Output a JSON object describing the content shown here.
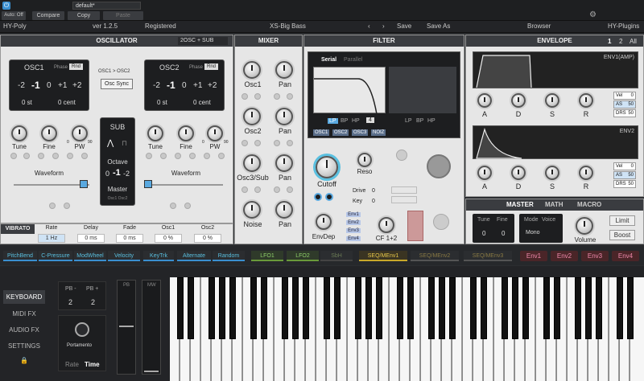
{
  "host": {
    "power_label": "⏻",
    "autooff": "Auto: Off",
    "preset": "default*",
    "compare": "Compare",
    "copy": "Copy",
    "paste": "Paste",
    "gear": "⚙"
  },
  "header": {
    "name": "HY-Poly",
    "version": "ver 1.2.5",
    "registered": "Registered",
    "preset": "XS-Big Bass",
    "save": "Save",
    "save_as": "Save As",
    "browser": "Browser",
    "brand": "HY-Plugins"
  },
  "osc": {
    "title": "OSCILLATOR",
    "mode": "2OSC + SUB",
    "osc1": "OSC1",
    "osc2": "OSC2",
    "phase": "Phase",
    "rnd": "Rnd",
    "link": "OSC1 > OSC2",
    "sync": "Osc Sync",
    "oct": [
      "-2",
      "-1",
      "0",
      "+1",
      "+2"
    ],
    "st": "0 st",
    "cent": "0 cent",
    "knobs": [
      "Tune",
      "Fine",
      "PW",
      "Tune",
      "Fine",
      "PW"
    ],
    "pw0": "0",
    "pw90": "90",
    "waveform": "Waveform",
    "sub": "SUB",
    "octave": "Octave",
    "sub_oct": [
      "0",
      "-1",
      "-2"
    ],
    "master": "Master",
    "master_opts": "Osc1 Osc2"
  },
  "vibrato": {
    "label": "VIBRATO",
    "rate": "Rate",
    "rate_v": "1 Hz",
    "delay": "Delay",
    "delay_v": "0 ms",
    "fade": "Fade",
    "fade_v": "0 ms",
    "osc1": "Osc1",
    "osc1_v": "0 %",
    "osc2": "Osc2",
    "osc2_v": "0 %"
  },
  "mixer": {
    "title": "MIXER",
    "knobs": [
      "Osc1",
      "Pan",
      "Osc2",
      "Pan",
      "Osc3/Sub",
      "Pan",
      "Noise",
      "Pan"
    ]
  },
  "filter": {
    "title": "FILTER",
    "serial": "Serial",
    "parallel": "Parallel",
    "lp": "LP",
    "bp": "BP",
    "hp": "HP",
    "slope": "4",
    "srcs": [
      "OSC1",
      "OSC2",
      "OSC3",
      "NOIZ"
    ],
    "cutoff": "Cutoff",
    "reso": "Reso",
    "drive": "Drive",
    "key": "Key",
    "drive_v": "0",
    "key_v": "0",
    "envdep": "EnvDep",
    "cf": "CF 1+2",
    "envs": [
      "Env1",
      "Env2",
      "Env3",
      "Env4"
    ]
  },
  "envelope": {
    "title": "ENVELOPE",
    "tabs": [
      "1",
      "2",
      "All"
    ],
    "env1": "ENV1(AMP)",
    "env2": "ENV2",
    "adsr": [
      "A",
      "D",
      "S",
      "R"
    ],
    "vel": "Vel",
    "vel_v": "0",
    "as": "AS",
    "as_v": "50",
    "drs": "DRS",
    "drs_v": "50"
  },
  "master": {
    "tabs": [
      "MASTER",
      "MATH",
      "MACRO"
    ],
    "tune": "Tune",
    "fine": "Fine",
    "tune_v": "0",
    "fine_v": "0",
    "mode": "Mode",
    "voice": "Voice",
    "mode_v": "Mono",
    "volume": "Volume",
    "limit": "Limit",
    "boost": "Boost"
  },
  "mod": {
    "tabs": [
      "PitchBend",
      "C-Pressure",
      "ModWheel",
      "Velocity",
      "KeyTrk",
      "Alternate",
      "Random"
    ],
    "lfo": [
      "LFO1",
      "LFO2",
      "SbH"
    ],
    "seq": [
      "SEQ/MEnv1",
      "SEQ/MEnv2",
      "SEQ/MEnv3"
    ],
    "env": [
      "Env1",
      "Env2",
      "Env3",
      "Env4"
    ]
  },
  "side": {
    "items": [
      "KEYBOARD",
      "MIDI FX",
      "AUDIO FX",
      "SETTINGS"
    ],
    "lock": "🔒"
  },
  "keyboard": {
    "pbm": "PB -",
    "pbp": "PB +",
    "pbm_v": "2",
    "pbp_v": "2",
    "pb": "PB",
    "mw": "MW",
    "portamento": "Portamento",
    "rate": "Rate",
    "time": "Time"
  }
}
